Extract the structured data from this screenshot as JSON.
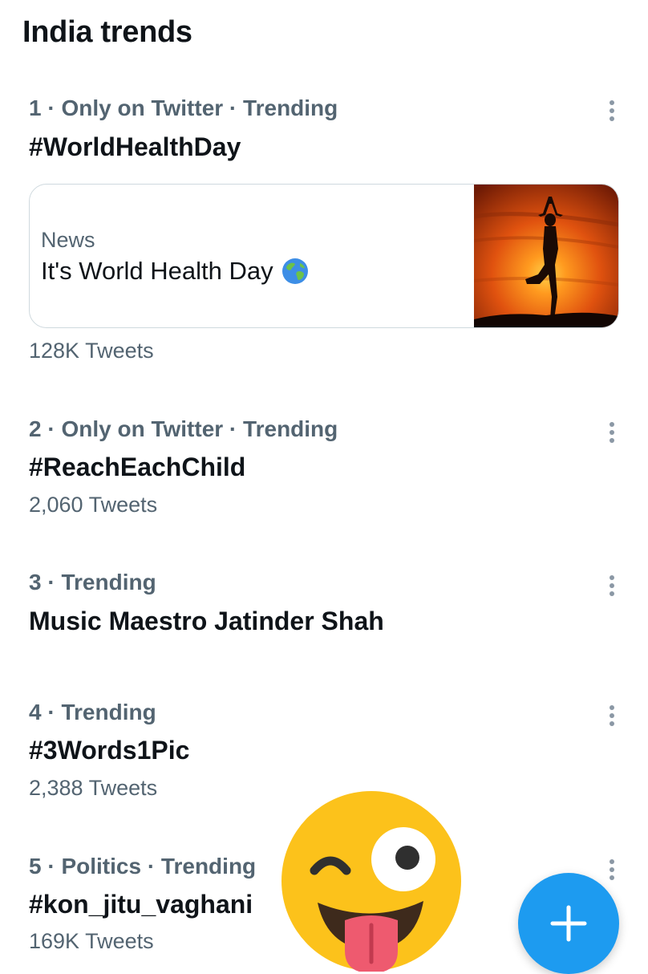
{
  "header": {
    "title": "India trends"
  },
  "trends": [
    {
      "meta": "1 · Only on Twitter · Trending",
      "name": "#WorldHealthDay",
      "count": "128K Tweets",
      "news": {
        "label": "News",
        "title": "It's World Health Day",
        "title_emoji": "globe-asia-australia",
        "image": "yoga-silhouette-sunset"
      }
    },
    {
      "meta": "2 · Only on Twitter · Trending",
      "name": "#ReachEachChild",
      "count": "2,060 Tweets"
    },
    {
      "meta": "3 · Trending",
      "name": "Music Maestro Jatinder Shah"
    },
    {
      "meta": "4 · Trending",
      "name": "#3Words1Pic",
      "count": "2,388 Tweets"
    },
    {
      "meta": "5 · Politics · Trending",
      "name": "#kon_jitu_vaghani",
      "count": "169K Tweets"
    }
  ],
  "icons": {
    "more": "more-vertical-icon",
    "compose": "plus-icon",
    "sticker": "winking-tongue-face-emoji"
  },
  "colors": {
    "accent": "#1d9bf0",
    "text_primary": "#0f1419",
    "text_secondary": "#536471",
    "card_border": "#cfd9de",
    "emoji_yellow": "#fcc21b"
  }
}
